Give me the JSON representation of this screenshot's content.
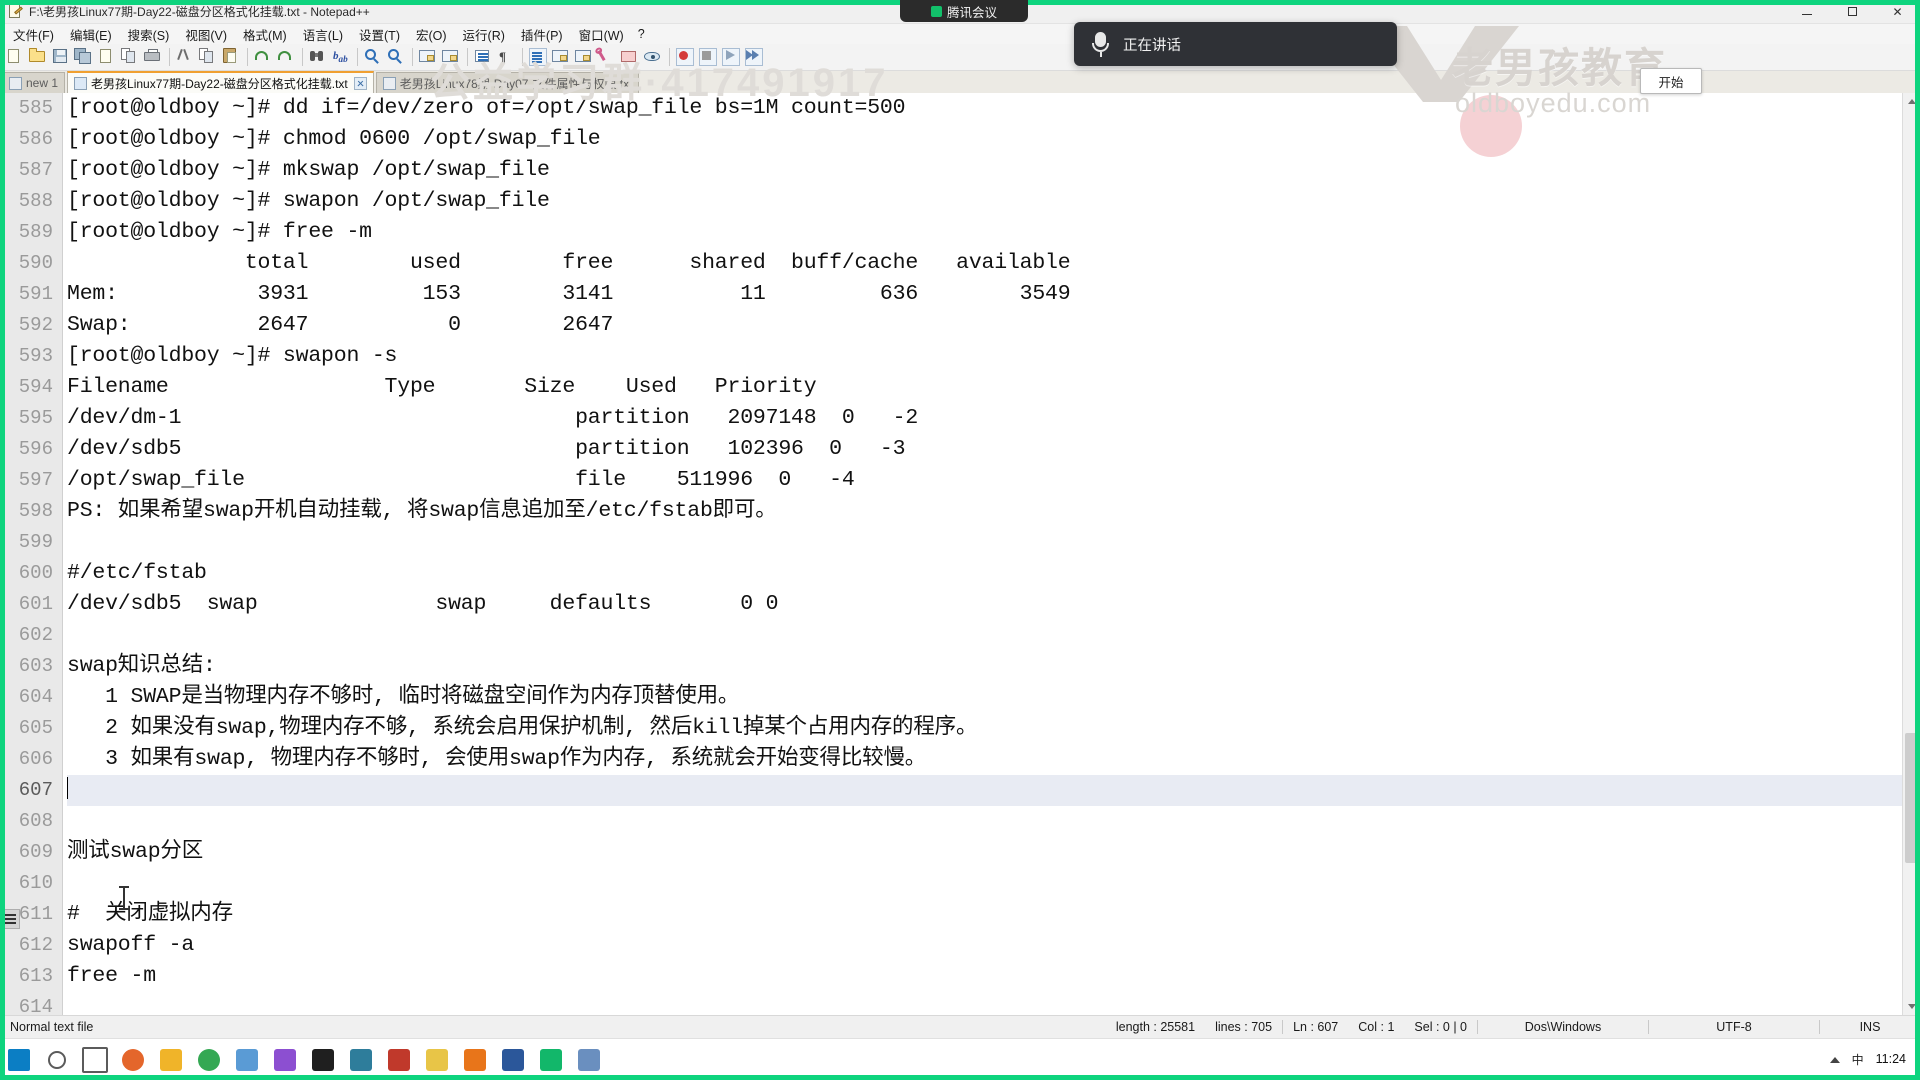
{
  "window": {
    "title": "F:\\老男孩Linux77期-Day22-磁盘分区格式化挂载.txt - Notepad++",
    "minimize_label": "",
    "maximize_label": "",
    "close_label": "✕"
  },
  "menu": {
    "items": [
      {
        "label": "文件(F)",
        "name": "menu-file"
      },
      {
        "label": "编辑(E)",
        "name": "menu-edit"
      },
      {
        "label": "搜索(S)",
        "name": "menu-search"
      },
      {
        "label": "视图(V)",
        "name": "menu-view"
      },
      {
        "label": "格式(M)",
        "name": "menu-format"
      },
      {
        "label": "语言(L)",
        "name": "menu-language"
      },
      {
        "label": "设置(T)",
        "name": "menu-settings"
      },
      {
        "label": "宏(O)",
        "name": "menu-macro"
      },
      {
        "label": "运行(R)",
        "name": "menu-run"
      },
      {
        "label": "插件(P)",
        "name": "menu-plugins"
      },
      {
        "label": "窗口(W)",
        "name": "menu-window"
      },
      {
        "label": "?",
        "name": "menu-help"
      }
    ]
  },
  "toolbar": {
    "icons": [
      "new-file-icon",
      "open-folder-icon",
      "save-icon",
      "save-all-icon",
      "close-file-icon",
      "close-all-icon",
      "print-icon",
      "cut-icon",
      "copy-icon",
      "paste-icon",
      "undo-icon",
      "redo-icon",
      "find-icon",
      "replace-icon",
      "zoom-in-icon",
      "zoom-out-icon",
      "sync-vertical-icon",
      "sync-horizontal-icon",
      "word-wrap-icon",
      "show-all-chars-icon",
      "indent-guide-icon",
      "ui-tab-icon",
      "user-defined-language-icon",
      "doc-map-icon",
      "function-list-icon",
      "folder-as-workspace-icon",
      "monitoring-icon",
      "record-macro-icon",
      "stop-macro-icon",
      "play-macro-icon",
      "run-macro-multiple-icon"
    ]
  },
  "tabs": [
    {
      "label": "new  1",
      "name": "tab-new-1",
      "active": false
    },
    {
      "label": "老男孩Linux77期-Day22-磁盘分区格式化挂载.txt",
      "name": "tab-day22",
      "active": true
    },
    {
      "label": "老男孩Linux78期-Day07-文件属性与权限.txt",
      "name": "tab-day07",
      "active": false
    }
  ],
  "editor": {
    "first_line_number": 585,
    "current_line": 607,
    "lines": [
      {
        "n": 585,
        "text": "[root@oldboy ~]# dd if=/dev/zero of=/opt/swap_file bs=1M count=500"
      },
      {
        "n": 586,
        "text": "[root@oldboy ~]# chmod 0600 /opt/swap_file"
      },
      {
        "n": 587,
        "text": "[root@oldboy ~]# mkswap /opt/swap_file"
      },
      {
        "n": 588,
        "text": "[root@oldboy ~]# swapon /opt/swap_file"
      },
      {
        "n": 589,
        "text": "[root@oldboy ~]# free -m"
      },
      {
        "n": 590,
        "text": "              total        used        free      shared  buff/cache   available"
      },
      {
        "n": 591,
        "text": "Mem:           3931         153        3141          11         636        3549"
      },
      {
        "n": 592,
        "text": "Swap:          2647           0        2647"
      },
      {
        "n": 593,
        "text": "[root@oldboy ~]# swapon -s"
      },
      {
        "n": 594,
        "text": "Filename                 Type       Size    Used   Priority"
      },
      {
        "n": 595,
        "text": "/dev/dm-1                               partition   2097148  0   -2"
      },
      {
        "n": 596,
        "text": "/dev/sdb5                               partition   102396  0   -3"
      },
      {
        "n": 597,
        "text": "/opt/swap_file                          file    511996  0   -4"
      },
      {
        "n": 598,
        "text": "PS: 如果希望swap开机自动挂载, 将swap信息追加至/etc/fstab即可。"
      },
      {
        "n": 599,
        "text": ""
      },
      {
        "n": 600,
        "text": "#/etc/fstab"
      },
      {
        "n": 601,
        "text": "/dev/sdb5  swap              swap     defaults       0 0"
      },
      {
        "n": 602,
        "text": ""
      },
      {
        "n": 603,
        "text": "swap知识总结:"
      },
      {
        "n": 604,
        "text": "   1 SWAP是当物理内存不够时, 临时将磁盘空间作为内存顶替使用。"
      },
      {
        "n": 605,
        "text": "   2 如果没有swap,物理内存不够, 系统会启用保护机制, 然后kill掉某个占用内存的程序。"
      },
      {
        "n": 606,
        "text": "   3 如果有swap, 物理内存不够时, 会使用swap作为内存, 系统就会开始变得比较慢。"
      },
      {
        "n": 607,
        "text": ""
      },
      {
        "n": 608,
        "text": ""
      },
      {
        "n": 609,
        "text": "测试swap分区"
      },
      {
        "n": 610,
        "text": ""
      },
      {
        "n": 611,
        "text": "#  关闭虚拟内存"
      },
      {
        "n": 612,
        "text": "swapoff -a"
      },
      {
        "n": 613,
        "text": "free -m"
      },
      {
        "n": 614,
        "text": ""
      }
    ]
  },
  "statusbar": {
    "doc_type": "Normal text file",
    "length": "length : 25581",
    "lines": "lines : 705",
    "ln": "Ln : 607",
    "col": "Col : 1",
    "sel": "Sel : 0 | 0",
    "eol": "Dos\\Windows",
    "encoding": "UTF-8",
    "insert_mode": "INS"
  },
  "overlays": {
    "meeting_pill": "腾讯会议",
    "speaking_label": "正在讲话",
    "start_button": "开始",
    "watermark_brand": "老男孩教育",
    "watermark_url": "oldboyedu.com",
    "watermark_center": "公益学习群·417491917",
    "watermark_center2": ""
  },
  "taskbar": {
    "items": [
      {
        "name": "taskbar-start-windows",
        "color": "#0b7ec4"
      },
      {
        "name": "taskbar-search-icon",
        "color": "#5b5b5b"
      },
      {
        "name": "taskbar-taskview-icon",
        "color": "#5b5b5b"
      },
      {
        "name": "taskbar-firefox-icon",
        "color": "#e4662b"
      },
      {
        "name": "taskbar-explorer-icon",
        "color": "#f0b429"
      },
      {
        "name": "taskbar-chrome-icon",
        "color": "#34a853"
      },
      {
        "name": "taskbar-app-icon",
        "color": "#5a9bd5"
      },
      {
        "name": "taskbar-media-icon",
        "color": "#8c4fd1"
      },
      {
        "name": "taskbar-terminal-icon",
        "color": "#1f1f1f"
      },
      {
        "name": "taskbar-calc-icon",
        "color": "#2e7d9b"
      },
      {
        "name": "taskbar-pdf-icon",
        "color": "#c0392b"
      },
      {
        "name": "taskbar-notes-icon",
        "color": "#e8c547"
      },
      {
        "name": "taskbar-notepadpp-icon",
        "color": "#e8751a"
      },
      {
        "name": "taskbar-word-icon",
        "color": "#2b579a"
      },
      {
        "name": "taskbar-meeting-icon",
        "color": "#12b76a"
      },
      {
        "name": "taskbar-browser2-icon",
        "color": "#6a8fbf"
      }
    ],
    "tray": {
      "time": "11:24",
      "date": "",
      "chev_label": "",
      "ime": "中"
    }
  }
}
